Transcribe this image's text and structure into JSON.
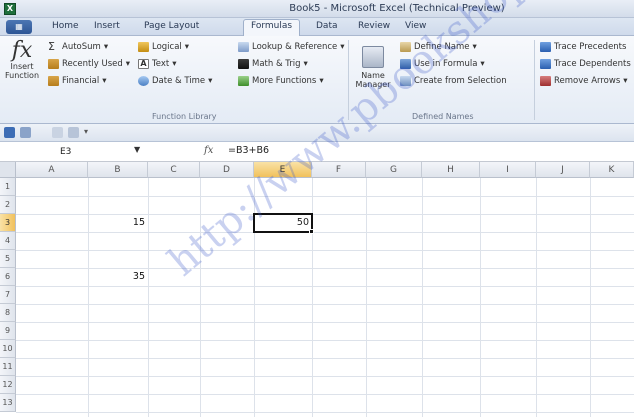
{
  "window": {
    "title": "Book5 - Microsoft Excel (Technical Preview)",
    "app_icon_letter": "X"
  },
  "ribbon_tabs": [
    "Home",
    "Insert",
    "Page Layout",
    "Formulas",
    "Data",
    "Review",
    "View"
  ],
  "active_tab": "Formulas",
  "function_library": {
    "insert_function": "Insert Function",
    "autosum": "AutoSum",
    "recently_used": "Recently Used",
    "financial": "Financial",
    "logical": "Logical",
    "text": "Text",
    "date_time": "Date & Time",
    "lookup_reference": "Lookup & Reference",
    "math_trig": "Math & Trig",
    "more_functions": "More Functions",
    "group_label": "Function Library"
  },
  "defined_names": {
    "name_manager": "Name Manager",
    "define_name": "Define Name",
    "use_in_formula": "Use in Formula",
    "create_from_selection": "Create from Selection",
    "group_label": "Defined Names"
  },
  "formula_auditing": {
    "trace_precedents": "Trace Precedents",
    "trace_dependents": "Trace Dependents",
    "remove_arrows": "Remove Arrows"
  },
  "formula_bar": {
    "name_box": "E3",
    "fx": "fx",
    "formula": "=B3+B6"
  },
  "columns": [
    "A",
    "B",
    "C",
    "D",
    "E",
    "F",
    "G",
    "H",
    "I",
    "J",
    "K"
  ],
  "rows": [
    "1",
    "2",
    "3",
    "4",
    "5",
    "6",
    "7",
    "8",
    "9",
    "10",
    "11",
    "12",
    "13"
  ],
  "cells": {
    "B3": "15",
    "B6": "35",
    "E3": "50"
  },
  "watermark": "http://www.pbookshop.com",
  "colors": {
    "selected_header": "#f1c15c",
    "ribbon": "#e4ebf5"
  }
}
